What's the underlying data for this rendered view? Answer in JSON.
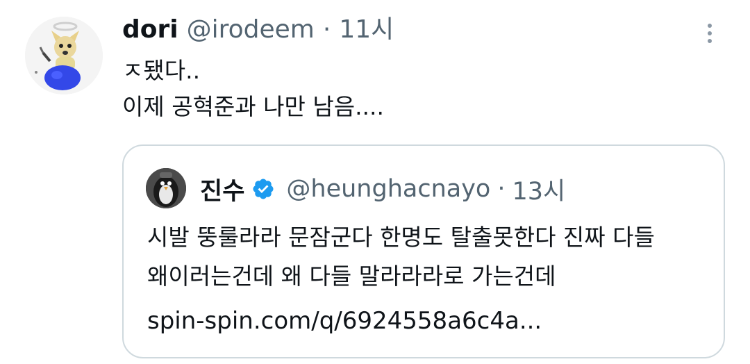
{
  "tweet": {
    "display_name": "dori",
    "handle": "@irodeem",
    "separator": "·",
    "time": "11시",
    "lines": [
      "ㅈ됐다..",
      "이제 공혁준과 나만 남음...."
    ],
    "more_icon": "more-vertical-icon",
    "avatar_icon": "dog-angel-avatar"
  },
  "quote": {
    "display_name": "진수",
    "verified_icon": "verified-badge-icon",
    "verified_color": "#1d9bf0",
    "handle": "@heunghacnayo",
    "separator": "·",
    "time": "13시",
    "lines": [
      "시발 뚱룰라라 문잠군다 한명도 탈출못한다 진짜 다들",
      "왜이러는건데 왜 다들 말라라라로 가는건데"
    ],
    "link": "spin-spin.com/q/6924558a6c4a..."
  },
  "colors": {
    "text": "#0f1419",
    "secondary": "#536471",
    "border": "#cfd9de",
    "accent": "#1d9bf0"
  }
}
